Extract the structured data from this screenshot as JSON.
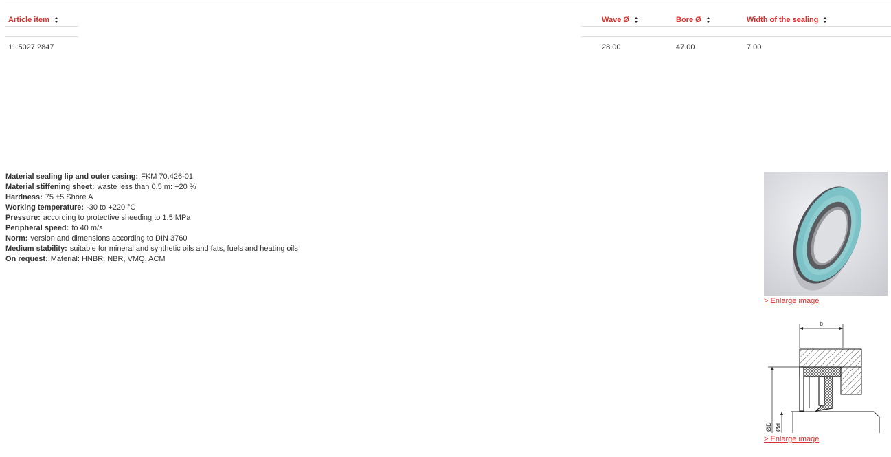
{
  "table": {
    "headers": [
      "Article item",
      "Wave Ø",
      "Bore Ø",
      "Width of the sealing"
    ],
    "row": [
      "11.5027.2847",
      "28.00",
      "47.00",
      "7.00"
    ]
  },
  "properties": [
    {
      "key": "Material sealing lip and outer casing:",
      "value": "FKM 70.426-01"
    },
    {
      "key": "Material stiffening sheet:",
      "value": "waste less than 0.5 m: +20 %"
    },
    {
      "key": "Hardness:",
      "value": "75 ±5 Shore A"
    },
    {
      "key": "Working temperature:",
      "value": "-30 to +220 °C"
    },
    {
      "key": "Pressure:",
      "value": "according to protective sheeding to 1.5 MPa"
    },
    {
      "key": "Peripheral speed:",
      "value": "to 40 m/s"
    },
    {
      "key": "Norm:",
      "value": "version and dimensions according to DIN 3760"
    },
    {
      "key": "Medium stability:",
      "value": "suitable for mineral and synthetic oils and fats, fuels and heating oils"
    },
    {
      "key": "On request:",
      "value": "Material: HNBR, NBR, VMQ, ACM"
    }
  ],
  "images": {
    "enlarge_label_1": "> Enlarge image",
    "enlarge_label_2": "> Enlarge image"
  },
  "drawing": {
    "label_b": "b",
    "label_D": "ØD",
    "label_d": "Ød"
  },
  "colors": {
    "accent": "#d9302c",
    "seal_body": "#7cc2c6",
    "photo_bg": "#e7e8ec"
  }
}
